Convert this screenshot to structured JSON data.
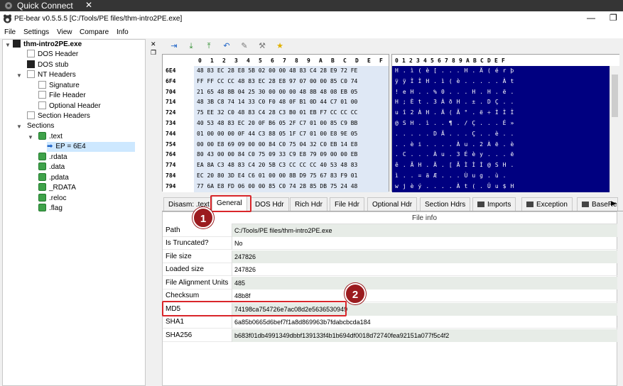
{
  "topbar": {
    "title": "Quick Connect",
    "close_glyph": "✕"
  },
  "window": {
    "title": "PE-bear v0.5.5.5 [C:/Tools/PE files/thm-intro2PE.exe]",
    "minimize": "—",
    "restore": "❐"
  },
  "menu": [
    "File",
    "Settings",
    "View",
    "Compare",
    "Info"
  ],
  "tree": {
    "root": "thm-intro2PE.exe",
    "dos_header": "DOS Header",
    "dos_stub": "DOS stub",
    "nt_headers": "NT Headers",
    "signature": "Signature",
    "file_header": "File Header",
    "optional_header": "Optional Header",
    "section_headers": "Section Headers",
    "sections": "Sections",
    "text": ".text",
    "ep": "EP = 6E4",
    "rdata": ".rdata",
    "data": ".data",
    "pdata": ".pdata",
    "RDATA": "_RDATA",
    "reloc": ".reloc",
    "flag": ".flag"
  },
  "hex": {
    "columns": [
      "0",
      "1",
      "2",
      "3",
      "4",
      "5",
      "6",
      "7",
      "8",
      "9",
      "A",
      "B",
      "C",
      "D",
      "E",
      "F"
    ],
    "offsets": [
      "6E4",
      "6F4",
      "704",
      "714",
      "724",
      "734",
      "744",
      "754",
      "764",
      "774",
      "784",
      "794"
    ],
    "rows": [
      "48 83 EC 28 E8 5B 02 00 00 48 83 C4 28 E9 72 FE",
      "FF FF CC CC 48 83 EC 28 E8 97 07 00 00 85 C0 74",
      "21 65 48 8B 04 25 30 00 00 00 48 8B 48 08 EB 05",
      "48 3B C8 74 14 33 C0 F0 48 0F B1 0D 44 C7 01 00",
      "75 EE 32 C0 48 83 C4 28 C3 B0 01 EB F7 CC CC CC",
      "40 53 48 83 EC 20 0F B6 05 2F C7 01 00 85 C9 BB",
      "01 00 00 00 0F 44 C3 88 05 1F C7 01 00 E8 9E 05",
      "00 00 E8 69 09 00 00 84 C0 75 04 32 C0 EB 14 E8",
      "80 43 00 00 84 C0 75 09 33 C9 E8 79 09 00 00 EB",
      "EA 8A C3 48 83 C4 20 5B C3 CC CC CC 40 53 48 83",
      "EC 20 80 3D E4 C6 01 00 00 8B D9 75 67 83 F9 01",
      "77 6A E8 FD 06 00 00 85 C0 74 28 85 DB 75 24 48"
    ],
    "ascii": [
      "H . ì ( è [ . . . H . Ä ( é r þ",
      "ÿ ÿ Ì Ì H . ì ( è . . . . . À t",
      "! e H . . % 0 . . . H . H . ë .",
      "H ; È t . 3 À ð H . ± . D Ç . .",
      "u î 2 À H . Ä ( Ã ° . ë ÷ Ì Ì Ì",
      "@ S H . ì . . ¶ . / Ç . . . É »",
      ". . . . . D Ã . . . Ç . . è . .",
      ". . è i . . . . À u . 2 À ë . è",
      ". C . . . À u . 3 É è y . . . ë",
      "ê . Ã H . Ä . [ Ã Ì Ì Ì @ S H .",
      "ì . . = ä Æ . . . Ù u g . ù .",
      "w j è ý . . . . À t ( . Û u $ H"
    ]
  },
  "tabs": [
    "Disasm: .text",
    "General",
    "DOS Hdr",
    "Rich Hdr",
    "File Hdr",
    "Optional Hdr",
    "Section Hdrs",
    "Imports",
    "Exception",
    "BaseReloc"
  ],
  "grid": {
    "header": "File info",
    "rows": [
      {
        "key": "Path",
        "value": "C:/Tools/PE files/thm-intro2PE.exe"
      },
      {
        "key": "Is Truncated?",
        "value": "No"
      },
      {
        "key": "File size",
        "value": "247826"
      },
      {
        "key": "Loaded size",
        "value": "247826"
      },
      {
        "key": "File Alignment Units",
        "value": "485"
      },
      {
        "key": "Checksum",
        "value": "48b8f"
      },
      {
        "key": "MD5",
        "value": "74198ca754726e7ac08d2e5636530949"
      },
      {
        "key": "SHA1",
        "value": "6a85b0665d6bef7f1a8d869963b7fdabcbcda184"
      },
      {
        "key": "SHA256",
        "value": "b683f01db4991349dbbf139133f4b1b694df0018d72740fea92151a077f5c4f2"
      }
    ]
  },
  "badges": [
    "1",
    "2"
  ],
  "colors": {
    "ascii_bg": "#000080",
    "hex_bg": "#dfe8f5",
    "callout": "#d9262a",
    "badge": "#9b1b1f"
  }
}
